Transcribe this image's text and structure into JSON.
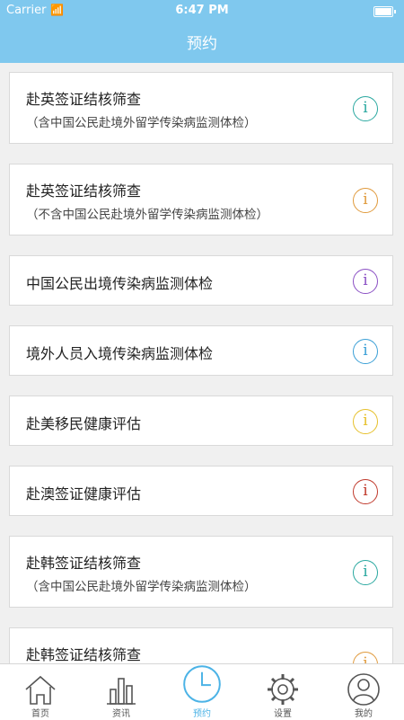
{
  "status": {
    "carrier": "Carrier",
    "time": "6:47 PM"
  },
  "header": {
    "title": "预约"
  },
  "list": [
    {
      "title": "赴英签证结核筛查",
      "subtitle": "（含中国公民赴境外留学传染病监测体检）",
      "icon_color": "#2aa8a0"
    },
    {
      "title": "赴英签证结核筛查",
      "subtitle": "（不含中国公民赴境外留学传染病监测体检）",
      "icon_color": "#e09a3c"
    },
    {
      "title": "中国公民出境传染病监测体检",
      "subtitle": "",
      "icon_color": "#8a4fc4"
    },
    {
      "title": "境外人员入境传染病监测体检",
      "subtitle": "",
      "icon_color": "#3a9fd6"
    },
    {
      "title": "赴美移民健康评估",
      "subtitle": "",
      "icon_color": "#e6c02a"
    },
    {
      "title": "赴澳签证健康评估",
      "subtitle": "",
      "icon_color": "#c0392b"
    },
    {
      "title": "赴韩签证结核筛查",
      "subtitle": "（含中国公民赴境外留学传染病监测体检）",
      "icon_color": "#2aa8a0"
    },
    {
      "title": "赴韩签证结核筛查",
      "subtitle": "",
      "icon_color": "#e09a3c"
    }
  ],
  "info_glyph": "i",
  "tabs": [
    {
      "label": "首页",
      "icon": "home-icon"
    },
    {
      "label": "资讯",
      "icon": "bar-chart-icon"
    },
    {
      "label": "预约",
      "icon": "clock-icon"
    },
    {
      "label": "设置",
      "icon": "gear-icon"
    },
    {
      "label": "我的",
      "icon": "user-icon"
    }
  ],
  "active_tab": 2,
  "accent_color": "#7fc8ee"
}
